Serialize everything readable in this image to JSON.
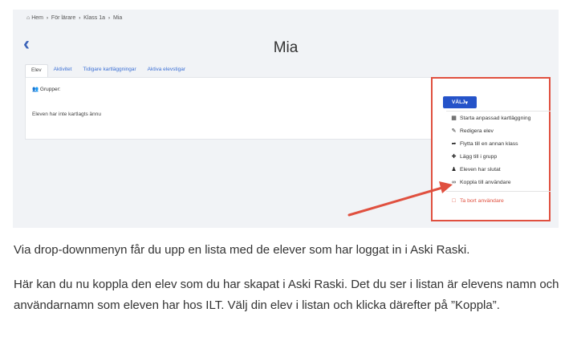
{
  "breadcrumb": {
    "home": "Hem",
    "teachers": "För lärare",
    "class": "Klass 1a",
    "current": "Mia"
  },
  "page": {
    "back_icon": "chevron-left-icon",
    "title": "Mia"
  },
  "tabs": [
    "Elev",
    "Aktivitet",
    "Tidigare kartläggningar",
    "Aktiva elevstigar"
  ],
  "panel": {
    "groups_label": "Grupper:",
    "not_mapped": "Eleven har inte kartlagts ännu"
  },
  "dropdown": {
    "button_label": "VÄLJ",
    "items": [
      {
        "icon": "map-icon",
        "label": "Starta anpassad kartläggning"
      },
      {
        "icon": "edit-icon",
        "label": "Redigera elev"
      },
      {
        "icon": "share-arrow-icon",
        "label": "Flytta till en annan klass"
      },
      {
        "icon": "plus-icon",
        "label": "Lägg till i grupp"
      },
      {
        "icon": "user-minus-icon",
        "label": "Eleven har slutat"
      },
      {
        "icon": "link-icon",
        "label": "Koppla till användare"
      }
    ],
    "danger_item": {
      "icon": "trash-icon",
      "label": "Ta bort användare"
    }
  },
  "text": {
    "p1": "Via drop-downmenyn får du upp en lista med de elever som har loggat in i Aski Raski.",
    "p2": "Här kan du nu koppla den elev som du har skapat i Aski Raski. Det du ser i listan är elevens namn och användarnamn som eleven har hos ILT. Välj din elev i listan och klicka därefter på ”Koppla”."
  },
  "colors": {
    "accent": "#2553c9",
    "annotation": "#e0503f",
    "link": "#3b6fd4"
  }
}
